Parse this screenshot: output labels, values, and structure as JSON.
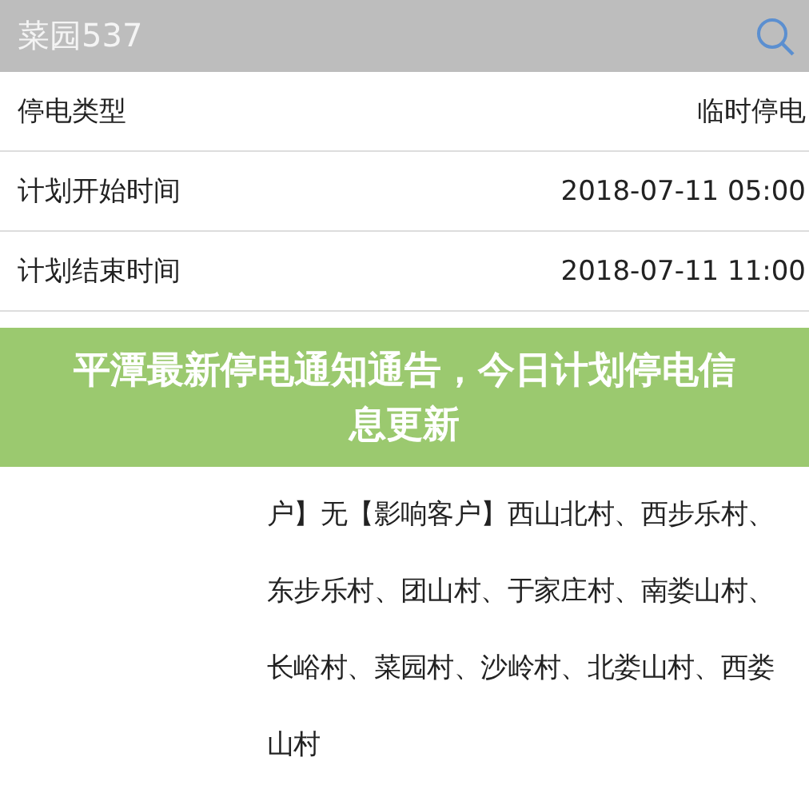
{
  "header": {
    "title": "菜园537"
  },
  "rows": [
    {
      "label": "停电类型",
      "value": "临时停电"
    },
    {
      "label": "计划开始时间",
      "value": "2018-07-11 05:00"
    },
    {
      "label": "计划结束时间",
      "value": "2018-07-11 11:00"
    }
  ],
  "banner": {
    "title": "平潭最新停电通知通告，今日计划停电信息更新"
  },
  "range": {
    "value_lines": [
      "户】无【影响客户】西山北村、西步乐村、",
      "东步乐村、团山村、于家庄村、南娄山村、",
      "长峪村、菜园村、沙岭村、北娄山村、西娄",
      "山村"
    ]
  }
}
